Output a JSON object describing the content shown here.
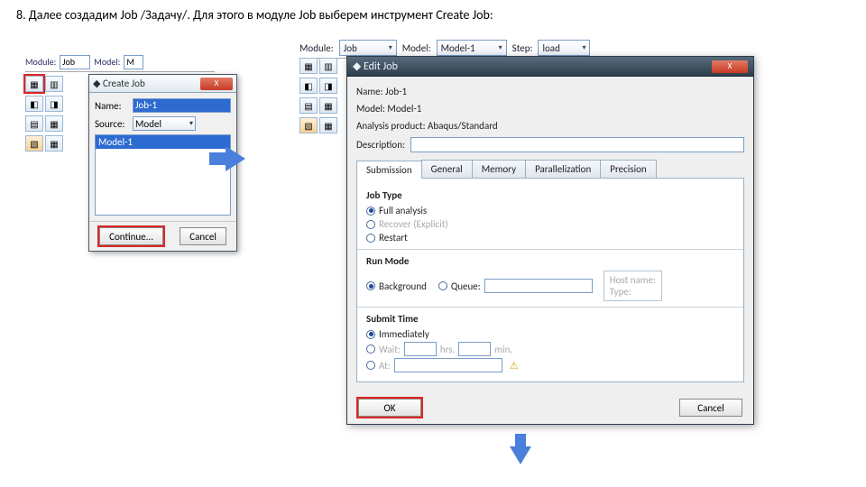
{
  "instruction": "8. Далее создадим Job /Задачу/. Для этого в модуле Job выберем инструмент Create Job:",
  "left": {
    "toolbar": {
      "module_label": "Module:",
      "module_value": "Job",
      "model_label": "Model:",
      "model_value": "M"
    },
    "dialog": {
      "title": "Create Job",
      "close": "X",
      "name_label": "Name:",
      "name_value": "Job-1",
      "source_label": "Source:",
      "source_value": "Model",
      "list_item": "Model-1",
      "continue": "Continue...",
      "cancel": "Cancel"
    }
  },
  "right": {
    "toolbar": {
      "module_label": "Module:",
      "module_value": "Job",
      "model_label": "Model:",
      "model_value": "Model-1",
      "step_label": "Step:",
      "step_value": "load"
    },
    "dialog": {
      "title": "Edit Job",
      "close": "X",
      "name_row": "Name:  Job-1",
      "model_row": "Model: Model-1",
      "analysis_row": "Analysis product: Abaqus/Standard",
      "description_label": "Description:",
      "tabs": {
        "submission": "Submission",
        "general": "General",
        "memory": "Memory",
        "parallel": "Parallelization",
        "precision": "Precision"
      },
      "jobtype_title": "Job Type",
      "jt_full": "Full analysis",
      "jt_recover": "Recover (Explicit)",
      "jt_restart": "Restart",
      "runmode_title": "Run Mode",
      "rm_bg": "Background",
      "rm_queue": "Queue:",
      "host_label": "Host name:",
      "type_label": "Type:",
      "submit_title": "Submit Time",
      "st_imm": "Immediately",
      "st_wait": "Wait:",
      "st_hrs": "hrs.",
      "st_min": "min.",
      "st_at": "At:",
      "ok": "OK",
      "cancel": "Cancel"
    }
  }
}
